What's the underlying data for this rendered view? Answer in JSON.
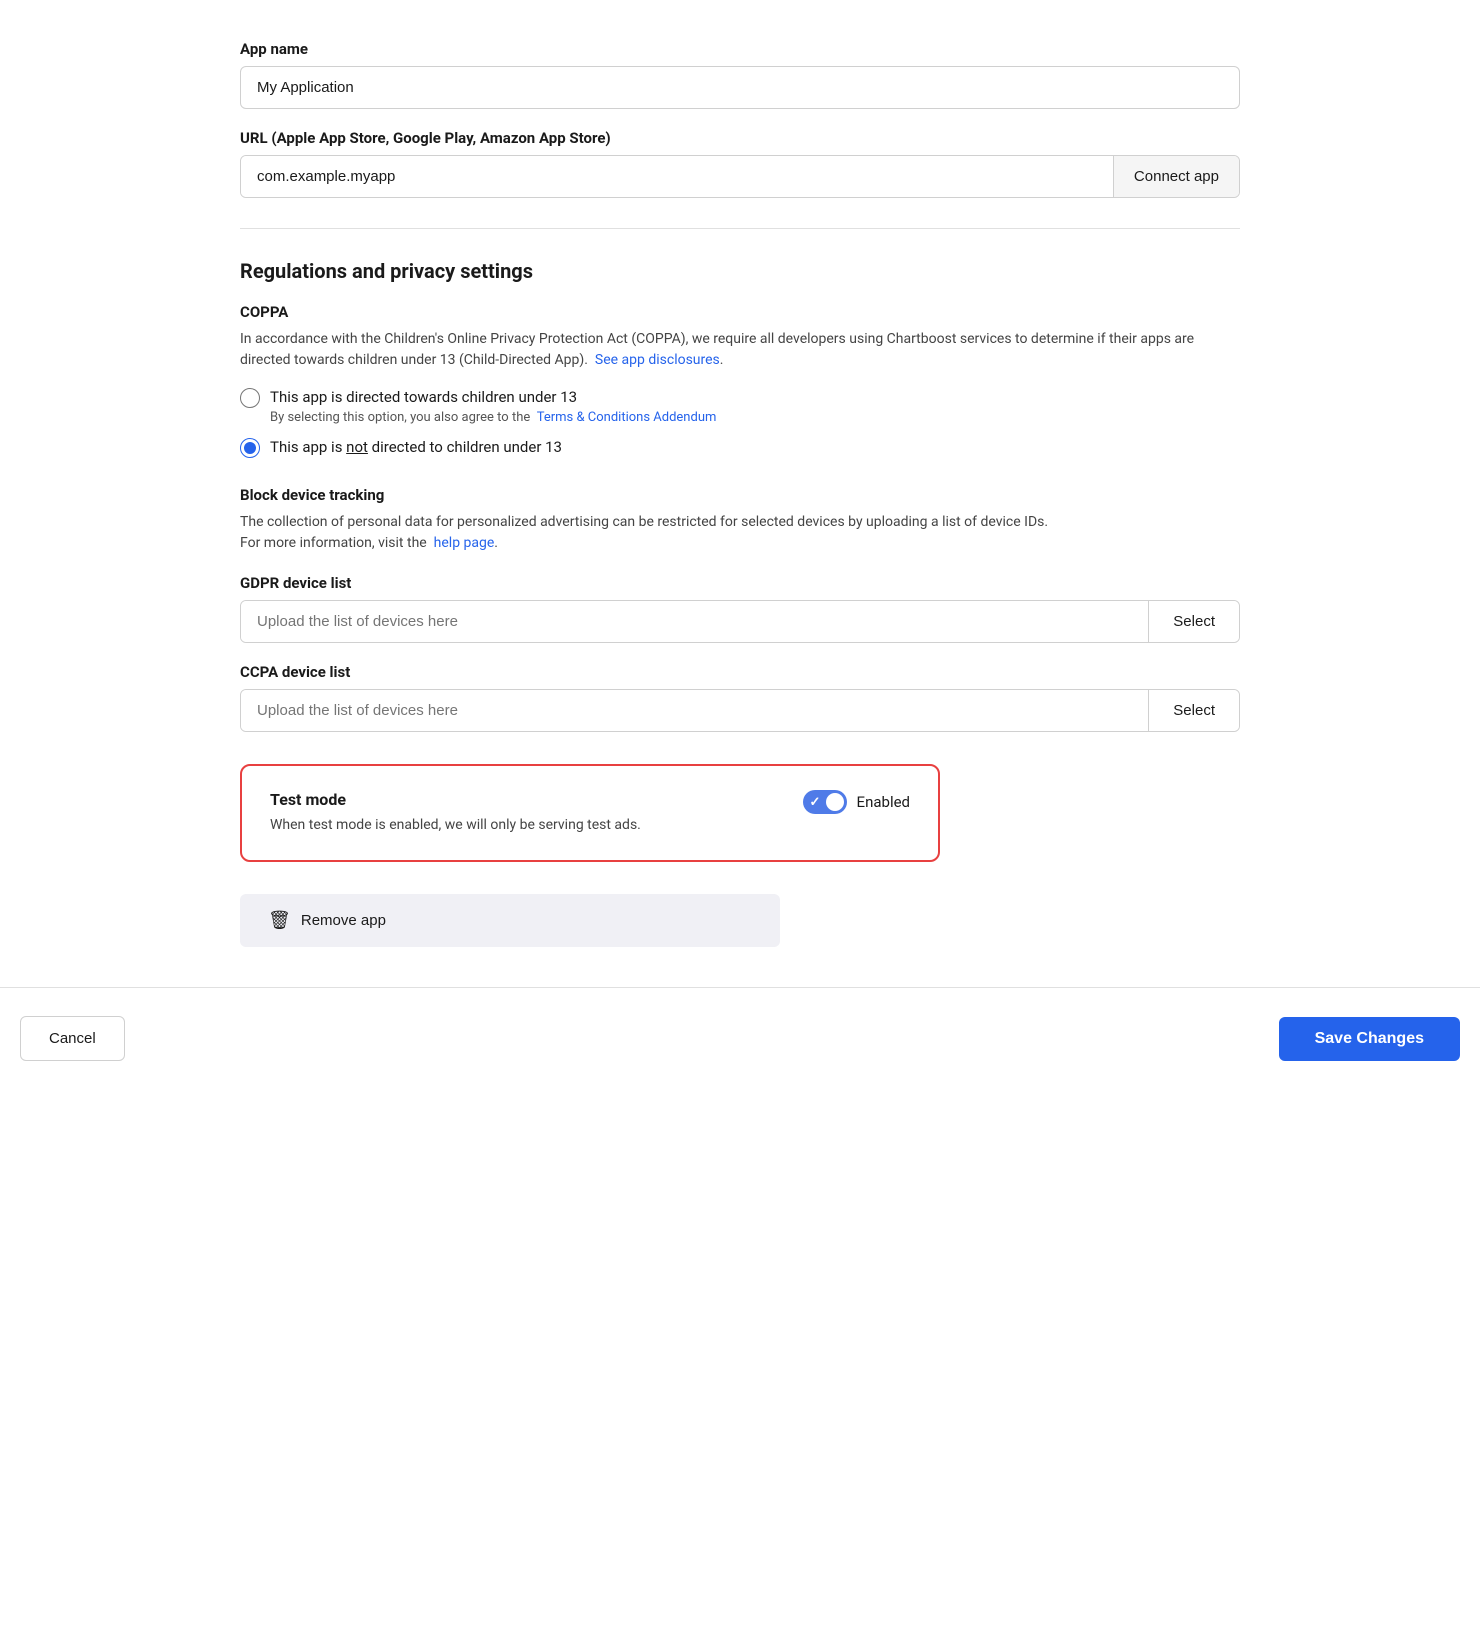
{
  "app_name": {
    "label": "App name",
    "value": "My Application",
    "placeholder": "My Application"
  },
  "url_field": {
    "label": "URL (Apple App Store, Google Play, Amazon App Store)",
    "value": "com.example.myapp",
    "placeholder": "com.example.myapp",
    "connect_btn": "Connect app"
  },
  "regulations": {
    "section_title": "Regulations and privacy settings",
    "coppa": {
      "title": "COPPA",
      "description_1": "In accordance with the Children's Online Privacy Protection Act (COPPA), we require all developers using Chartboost services to determine if their apps are directed towards children under 13 (Child-Directed App).",
      "see_disclosures_link": "See app disclosures",
      "radio_child": "This app is directed towards children under 13",
      "radio_child_sub_1": "By selecting this option, you also agree to the",
      "terms_link": "Terms & Conditions Addendum",
      "radio_not_child": "This app is",
      "radio_not_child_underline": "not",
      "radio_not_child_2": "directed to children under 13"
    },
    "block_tracking": {
      "title": "Block device tracking",
      "description_1": "The collection of personal data for personalized advertising can be restricted for selected devices by uploading a list of device IDs.",
      "description_2": "For more information, visit the",
      "help_link": "help page"
    },
    "gdpr": {
      "label": "GDPR device list",
      "placeholder": "Upload the list of devices here",
      "select_btn": "Select"
    },
    "ccpa": {
      "label": "CCPA device list",
      "placeholder": "Upload the list of devices here",
      "select_btn": "Select"
    }
  },
  "test_mode": {
    "title": "Test mode",
    "description": "When test mode is enabled, we will only be serving test ads.",
    "enabled_label": "Enabled",
    "enabled": true
  },
  "remove_app": {
    "label": "Remove app"
  },
  "footer": {
    "cancel_label": "Cancel",
    "save_label": "Save Changes"
  }
}
